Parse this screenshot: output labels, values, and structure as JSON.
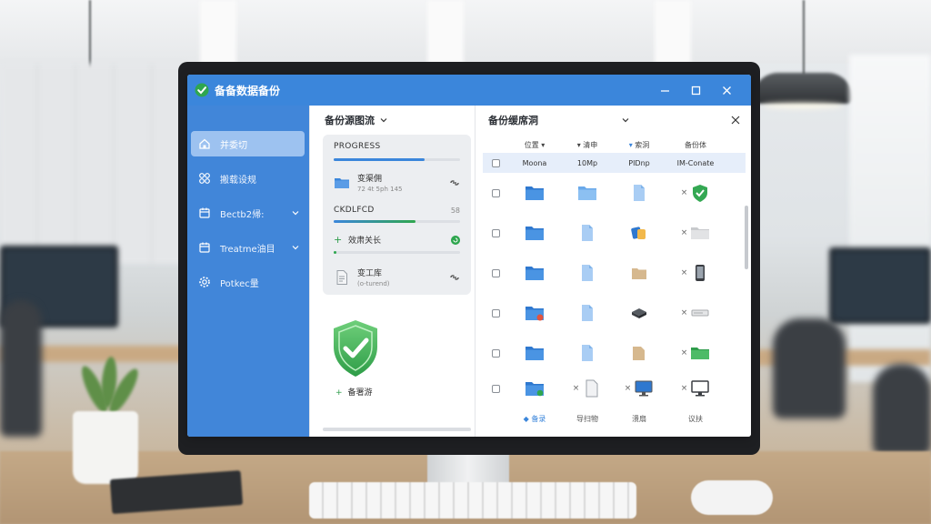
{
  "window": {
    "title": "备备数据备份"
  },
  "sidebar": {
    "items": [
      {
        "label": "并委切",
        "icon": "home-icon",
        "active": true,
        "expandable": false
      },
      {
        "label": "搬载设规",
        "icon": "nodes-icon",
        "active": false,
        "expandable": false
      },
      {
        "label": "Bectb2帰:",
        "icon": "calendar-icon",
        "active": false,
        "expandable": true
      },
      {
        "label": "Treatme油目",
        "icon": "calendar-icon",
        "active": false,
        "expandable": true
      },
      {
        "label": "Potkec量",
        "icon": "gear-icon",
        "active": false,
        "expandable": false
      }
    ]
  },
  "middle": {
    "header": "备份源图流",
    "progress_label": "PROGRESS",
    "progress_1": 0.72,
    "file_1": {
      "name": "变渠佣",
      "sub": "72 4t 5ph 145"
    },
    "section_2_label": "CKDLFCD",
    "section_2_pct": "58",
    "progress_2": 0.65,
    "mini_item": "效肃关长",
    "file_2": {
      "name": "变工库",
      "sub": "(o-turend)"
    },
    "secure_label": "备署游"
  },
  "right": {
    "header": "备份缓席洞",
    "columns": [
      "位置",
      "清申",
      "索洞",
      "备份体"
    ],
    "selected_row": [
      "Moona",
      "10Mp",
      "PIDnp",
      "IM-Conate"
    ],
    "rows": [
      {
        "c2": "folder-icon",
        "c3": "document-icon",
        "c4x": true,
        "c4": "shield-check-icon"
      },
      {
        "c2": "document-icon",
        "c3": "apps-icon",
        "c4x": true,
        "c4": "folder-gray-icon"
      },
      {
        "c2": "document-icon",
        "c3": "box-icon",
        "c4x": true,
        "c4": "phone-icon"
      },
      {
        "c2": "document-icon",
        "c3": "disk-icon",
        "c4x": true,
        "c4": "drive-icon"
      },
      {
        "c2": "document-icon",
        "c3": "box-icon",
        "c4x": true,
        "c4": "folder-green-icon"
      },
      {
        "c2x": true,
        "c2": "page-icon",
        "c3x": true,
        "c3": "monitor-icon",
        "c4x": true,
        "c4": "tv-icon"
      }
    ],
    "footer": [
      "备录",
      "导扫物",
      "溃扇",
      "议扶"
    ]
  },
  "colors": {
    "accent": "#3b86db",
    "sidebar": "#4186d9",
    "success": "#2fa64f"
  }
}
